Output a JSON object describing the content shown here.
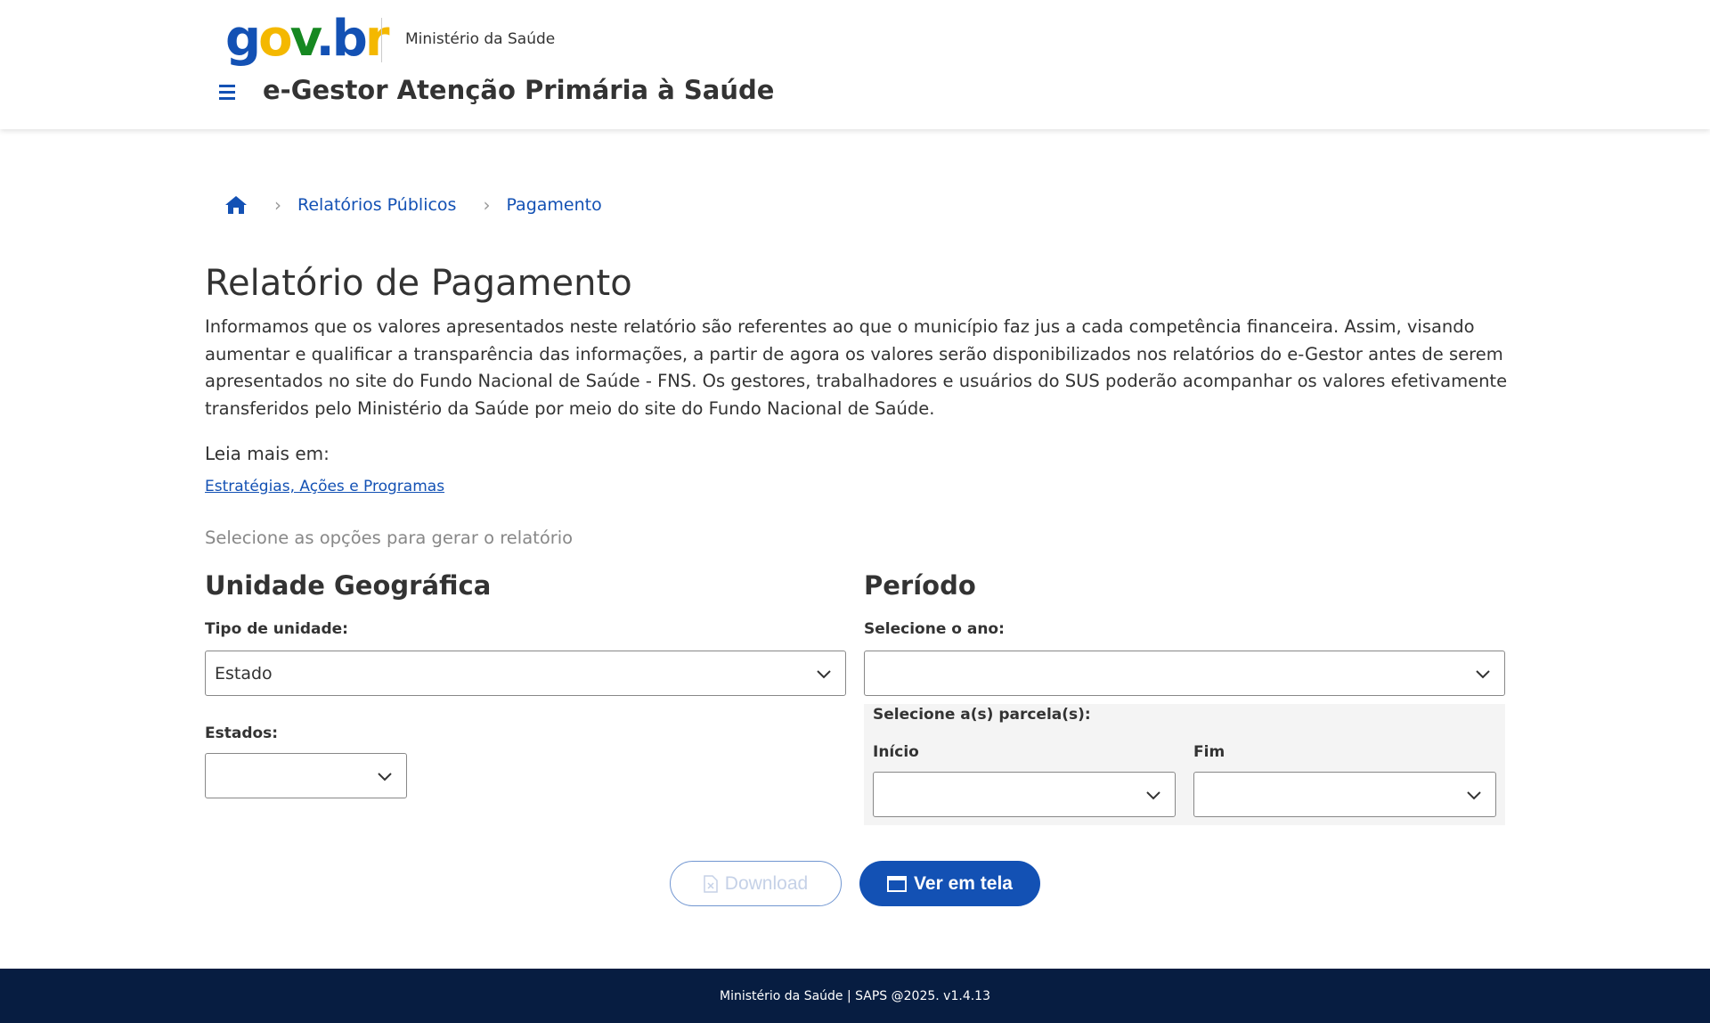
{
  "header": {
    "logo_parts": [
      "g",
      "o",
      "v",
      ".",
      "b",
      "r"
    ],
    "ministry": "Ministério da Saúde",
    "system_title": "e-Gestor Atenção Primária à Saúde"
  },
  "breadcrumb": {
    "items": [
      "Relatórios Públicos",
      "Pagamento"
    ]
  },
  "main": {
    "title": "Relatório de Pagamento",
    "intro": "Informamos que os valores apresentados neste relatório são referentes ao que o município faz jus a cada competência financeira. Assim, visando aumentar e qualificar a transparência das informações, a partir de agora os valores serão disponibilizados nos relatórios do e-Gestor antes de serem apresentados no site do Fundo Nacional de Saúde - FNS. Os gestores, trabalhadores e usuários do SUS poderão acompanhar os valores efetivamente transferidos pelo Ministério da Saúde por meio do site do Fundo Nacional de Saúde.",
    "leia_mais": "Leia mais em:",
    "leia_link": "Estratégias, Ações e Programas",
    "select_hint": "Selecione as opções para gerar o relatório"
  },
  "geo": {
    "title": "Unidade Geográfica",
    "tipo_label": "Tipo de unidade:",
    "tipo_value": "Estado",
    "estados_label": "Estados:",
    "estados_value": ""
  },
  "periodo": {
    "title": "Período",
    "ano_label": "Selecione o ano:",
    "ano_value": "",
    "parcelas_label": "Selecione a(s) parcela(s):",
    "inicio_label": "Início",
    "inicio_value": "",
    "fim_label": "Fim",
    "fim_value": ""
  },
  "actions": {
    "download": "Download",
    "ver": "Ver em tela"
  },
  "footer": {
    "text": "Ministério da Saúde | SAPS @2025. v1.4.13"
  },
  "colors": {
    "primary": "#1351b4",
    "footer_bg": "#071d41"
  }
}
